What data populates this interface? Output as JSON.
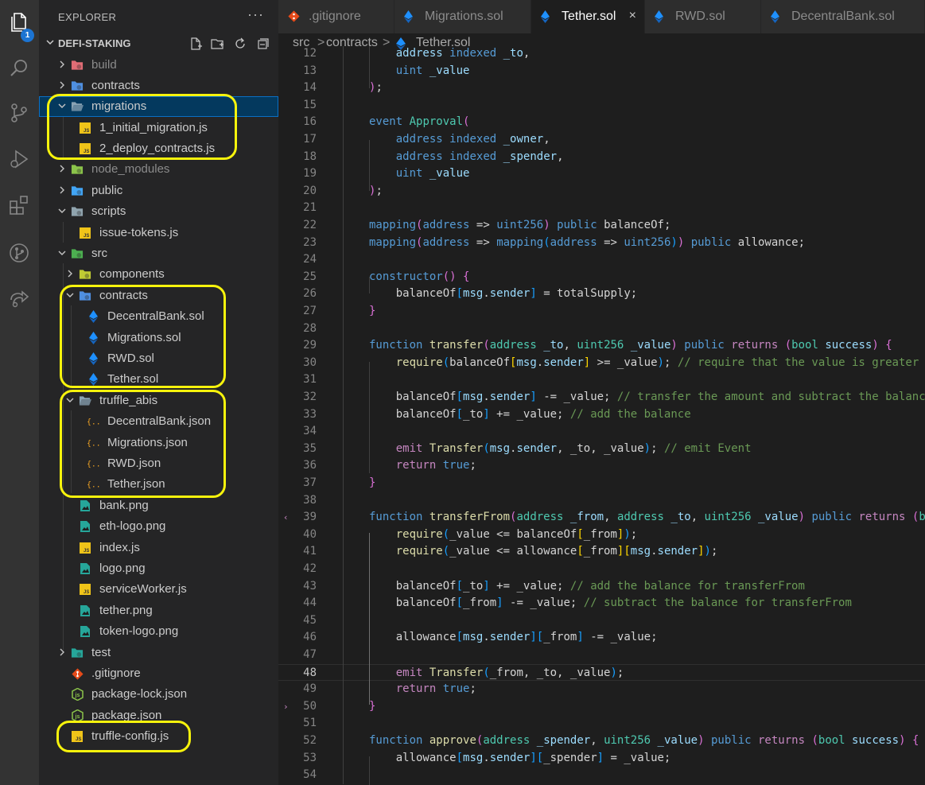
{
  "activity_bar": {
    "items": [
      {
        "name": "explorer-icon",
        "active": true,
        "badge": "1"
      },
      {
        "name": "search-icon"
      },
      {
        "name": "source-control-icon"
      },
      {
        "name": "run-debug-icon"
      },
      {
        "name": "extensions-icon"
      },
      {
        "name": "git-graph-icon"
      },
      {
        "name": "remote-share-icon"
      }
    ]
  },
  "sidebar": {
    "title": "EXPLORER",
    "more": "···",
    "project": {
      "name": "DEFI-STAKING",
      "actions": [
        "new-file-icon",
        "new-folder-icon",
        "refresh-icon",
        "collapse-all-icon"
      ]
    },
    "tree": [
      {
        "label": "build",
        "type": "folder",
        "depth": 0,
        "expanded": false,
        "icon": "build-folder-icon",
        "color": "#e06c75",
        "dim": true
      },
      {
        "label": "contracts",
        "type": "folder",
        "depth": 0,
        "expanded": false,
        "icon": "contracts-folder-icon",
        "color": "#4f8fe0"
      },
      {
        "label": "migrations",
        "type": "folder",
        "depth": 0,
        "expanded": true,
        "icon": "folder-open-icon",
        "color": "#8aa3b4",
        "selected": true
      },
      {
        "label": "1_initial_migration.js",
        "type": "js",
        "depth": 1
      },
      {
        "label": "2_deploy_contracts.js",
        "type": "js",
        "depth": 1
      },
      {
        "label": "node_modules",
        "type": "folder",
        "depth": 0,
        "expanded": false,
        "icon": "node-folder-icon",
        "color": "#8bc34a",
        "dim": true
      },
      {
        "label": "public",
        "type": "folder",
        "depth": 0,
        "expanded": false,
        "icon": "public-folder-icon",
        "color": "#42a5f5"
      },
      {
        "label": "scripts",
        "type": "folder",
        "depth": 0,
        "expanded": true,
        "icon": "scripts-folder-icon",
        "color": "#90a4ae"
      },
      {
        "label": "issue-tokens.js",
        "type": "js",
        "depth": 1
      },
      {
        "label": "src",
        "type": "folder",
        "depth": 0,
        "expanded": true,
        "icon": "src-folder-icon",
        "color": "#4caf50"
      },
      {
        "label": "components",
        "type": "folder",
        "depth": 1,
        "expanded": false,
        "icon": "components-folder-icon",
        "color": "#c0ca33"
      },
      {
        "label": "contracts",
        "type": "folder",
        "depth": 1,
        "expanded": true,
        "icon": "contracts-folder-icon",
        "color": "#4f8fe0"
      },
      {
        "label": "DecentralBank.sol",
        "type": "sol",
        "depth": 2
      },
      {
        "label": "Migrations.sol",
        "type": "sol",
        "depth": 2
      },
      {
        "label": "RWD.sol",
        "type": "sol",
        "depth": 2
      },
      {
        "label": "Tether.sol",
        "type": "sol",
        "depth": 2
      },
      {
        "label": "truffle_abis",
        "type": "folder",
        "depth": 1,
        "expanded": true,
        "icon": "folder-open-icon",
        "color": "#8aa3b4"
      },
      {
        "label": "DecentralBank.json",
        "type": "json",
        "depth": 2
      },
      {
        "label": "Migrations.json",
        "type": "json",
        "depth": 2
      },
      {
        "label": "RWD.json",
        "type": "json",
        "depth": 2
      },
      {
        "label": "Tether.json",
        "type": "json",
        "depth": 2
      },
      {
        "label": "bank.png",
        "type": "png",
        "depth": 1
      },
      {
        "label": "eth-logo.png",
        "type": "png",
        "depth": 1
      },
      {
        "label": "index.js",
        "type": "js",
        "depth": 1
      },
      {
        "label": "logo.png",
        "type": "png",
        "depth": 1
      },
      {
        "label": "serviceWorker.js",
        "type": "js",
        "depth": 1
      },
      {
        "label": "tether.png",
        "type": "png",
        "depth": 1
      },
      {
        "label": "token-logo.png",
        "type": "png",
        "depth": 1
      },
      {
        "label": "test",
        "type": "folder",
        "depth": 0,
        "expanded": false,
        "icon": "test-folder-icon",
        "color": "#26a69a"
      },
      {
        "label": ".gitignore",
        "type": "git",
        "depth": 0
      },
      {
        "label": "package-lock.json",
        "type": "npm",
        "depth": 0
      },
      {
        "label": "package.json",
        "type": "npm",
        "depth": 0
      },
      {
        "label": "truffle-config.js",
        "type": "js",
        "depth": 0
      }
    ]
  },
  "tabs": [
    {
      "label": ".gitignore",
      "icon": "git-icon",
      "active": false
    },
    {
      "label": "Migrations.sol",
      "icon": "ethereum-icon",
      "active": false
    },
    {
      "label": "Tether.sol",
      "icon": "ethereum-icon",
      "active": true,
      "close": "×"
    },
    {
      "label": "RWD.sol",
      "icon": "ethereum-icon",
      "active": false
    },
    {
      "label": "DecentralBank.sol",
      "icon": "ethereum-icon",
      "active": false
    }
  ],
  "breadcrumb": {
    "parts": [
      "src",
      "contracts",
      "Tether.sol"
    ],
    "separator": ">"
  },
  "editor": {
    "current_line": 48,
    "lines": [
      {
        "n": 12,
        "html": "    <span class=\"v\">address</span> <span class=\"k\">indexed</span> <span class=\"v\">_to</span>,"
      },
      {
        "n": 13,
        "html": "    <span class=\"k\">uint</span> <span class=\"v\">_value</span>"
      },
      {
        "n": 14,
        "html": "<span class=\"b2\">)</span>;"
      },
      {
        "n": 15,
        "html": ""
      },
      {
        "n": 16,
        "html": "<span class=\"k\">event</span> <span class=\"t\">Approval</span><span class=\"b2\">(</span>"
      },
      {
        "n": 17,
        "html": "    <span class=\"k\">address</span> <span class=\"k\">indexed</span> <span class=\"v\">_owner</span>,"
      },
      {
        "n": 18,
        "html": "    <span class=\"k\">address</span> <span class=\"k\">indexed</span> <span class=\"v\">_spender</span>,"
      },
      {
        "n": 19,
        "html": "    <span class=\"k\">uint</span> <span class=\"v\">_value</span>"
      },
      {
        "n": 20,
        "html": "<span class=\"b2\">)</span>;"
      },
      {
        "n": 21,
        "html": ""
      },
      {
        "n": 22,
        "html": "<span class=\"k\">mapping</span><span class=\"b2\">(</span><span class=\"k\">address</span> => <span class=\"k\">uint256</span><span class=\"b2\">)</span> <span class=\"k\">public</span> balanceOf;"
      },
      {
        "n": 23,
        "html": "<span class=\"k\">mapping</span><span class=\"b2\">(</span><span class=\"k\">address</span> => <span class=\"k\">mapping</span><span class=\"b3\">(</span><span class=\"k\">address</span> => <span class=\"k\">uint256</span><span class=\"b3\">)</span><span class=\"b2\">)</span> <span class=\"k\">public</span> allowance;"
      },
      {
        "n": 24,
        "html": ""
      },
      {
        "n": 25,
        "html": "<span class=\"k\">constructor</span><span class=\"b2\">()</span> <span class=\"b2\">{</span>"
      },
      {
        "n": 26,
        "html": "    balanceOf<span class=\"b3\">[</span><span class=\"v\">msg</span>.<span class=\"v\">sender</span><span class=\"b3\">]</span> = totalSupply;"
      },
      {
        "n": 27,
        "html": "<span class=\"b2\">}</span>"
      },
      {
        "n": 28,
        "html": ""
      },
      {
        "n": 29,
        "html": "<span class=\"k\">function</span> <span class=\"f\">transfer</span><span class=\"b2\">(</span><span class=\"t\">address</span> <span class=\"v\">_to</span>, <span class=\"t\">uint256</span> <span class=\"v\">_value</span><span class=\"b2\">)</span> <span class=\"k\">public</span> <span class=\"p\">returns</span> <span class=\"b2\">(</span><span class=\"t\">bool</span> <span class=\"v\">success</span><span class=\"b2\">)</span> <span class=\"b2\">{</span>"
      },
      {
        "n": 30,
        "html": "    <span class=\"f\">require</span><span class=\"b3\">(</span>balanceOf<span class=\"b1\">[</span><span class=\"v\">msg</span>.<span class=\"v\">sender</span><span class=\"b1\">]</span> >= _value<span class=\"b3\">)</span>; <span class=\"c\">// require that the value is greater or equal for transfer</span>"
      },
      {
        "n": 31,
        "html": ""
      },
      {
        "n": 32,
        "html": "    balanceOf<span class=\"b3\">[</span><span class=\"v\">msg</span>.<span class=\"v\">sender</span><span class=\"b3\">]</span> -= _value; <span class=\"c\">// transfer the amount and subtract the balance</span>"
      },
      {
        "n": 33,
        "html": "    balanceOf<span class=\"b3\">[</span>_to<span class=\"b3\">]</span> += _value; <span class=\"c\">// add the balance</span>"
      },
      {
        "n": 34,
        "html": ""
      },
      {
        "n": 35,
        "html": "    <span class=\"p\">emit</span> <span class=\"f\">Transfer</span><span class=\"b3\">(</span><span class=\"v\">msg</span>.<span class=\"v\">sender</span>, _to, _value<span class=\"b3\">)</span>; <span class=\"c\">// emit Event</span>"
      },
      {
        "n": 36,
        "html": "    <span class=\"p\">return</span> <span class=\"k\">true</span>;"
      },
      {
        "n": 37,
        "html": "<span class=\"b2\">}</span>"
      },
      {
        "n": 38,
        "html": ""
      },
      {
        "n": 39,
        "html": "<span class=\"k\">function</span> <span class=\"f\">transferFrom</span><span class=\"b2\">(</span><span class=\"t\">address</span> <span class=\"v\">_from</span>, <span class=\"t\">address</span> <span class=\"v\">_to</span>, <span class=\"t\">uint256</span> <span class=\"v\">_value</span><span class=\"b2\">)</span> <span class=\"k\">public</span> <span class=\"p\">returns</span> <span class=\"b2\">(</span><span class=\"t\">bool</span> <span class=\"v\">success</span><span class=\"b2\">)</span> <span class=\"b2\">{</span>",
        "fold": "‹"
      },
      {
        "n": 40,
        "html": "    <span class=\"f\">require</span><span class=\"b3\">(</span>_value <= balanceOf<span class=\"b1\">[</span>_from<span class=\"b1\">]</span><span class=\"b3\">)</span>;"
      },
      {
        "n": 41,
        "html": "    <span class=\"f\">require</span><span class=\"b3\">(</span>_value <= allowance<span class=\"b1\">[</span>_from<span class=\"b1\">][</span><span class=\"v\">msg</span>.<span class=\"v\">sender</span><span class=\"b1\">]</span><span class=\"b3\">)</span>;"
      },
      {
        "n": 42,
        "html": ""
      },
      {
        "n": 43,
        "html": "    balanceOf<span class=\"b3\">[</span>_to<span class=\"b3\">]</span> += _value; <span class=\"c\">// add the balance for transferFrom</span>"
      },
      {
        "n": 44,
        "html": "    balanceOf<span class=\"b3\">[</span>_from<span class=\"b3\">]</span> -= _value; <span class=\"c\">// subtract the balance for transferFrom</span>"
      },
      {
        "n": 45,
        "html": ""
      },
      {
        "n": 46,
        "html": "    allowance<span class=\"b3\">[</span><span class=\"v\">msg</span>.<span class=\"v\">sender</span><span class=\"b3\">][</span>_from<span class=\"b3\">]</span> -= _value;"
      },
      {
        "n": 47,
        "html": ""
      },
      {
        "n": 48,
        "html": "    <span class=\"p\">emit</span> <span class=\"f\">Transfer</span><span class=\"b3\">(</span>_from, _to, _value<span class=\"b3\">)</span>;"
      },
      {
        "n": 49,
        "html": "    <span class=\"p\">return</span> <span class=\"k\">true</span>;"
      },
      {
        "n": 50,
        "html": "<span class=\"b2\">}</span>",
        "fold": "›"
      },
      {
        "n": 51,
        "html": ""
      },
      {
        "n": 52,
        "html": "<span class=\"k\">function</span> <span class=\"f\">approve</span><span class=\"b2\">(</span><span class=\"t\">address</span> <span class=\"v\">_spender</span>, <span class=\"t\">uint256</span> <span class=\"v\">_value</span><span class=\"b2\">)</span> <span class=\"k\">public</span> <span class=\"p\">returns</span> <span class=\"b2\">(</span><span class=\"t\">bool</span> <span class=\"v\">success</span><span class=\"b2\">)</span> <span class=\"b2\">{</span>"
      },
      {
        "n": 53,
        "html": "    allowance<span class=\"b3\">[</span><span class=\"v\">msg</span>.<span class=\"v\">sender</span><span class=\"b3\">][</span>_spender<span class=\"b3\">]</span> = _value;"
      },
      {
        "n": 54,
        "html": ""
      }
    ]
  },
  "colors": {
    "highlight": "#f7f30c",
    "js_icon": "#f0c419",
    "sol_icon": "#1e90ff",
    "json_icon": "#f5a623",
    "png_icon": "#26a69a",
    "git_icon": "#e64a19",
    "npm_icon": "#8bc34a"
  }
}
